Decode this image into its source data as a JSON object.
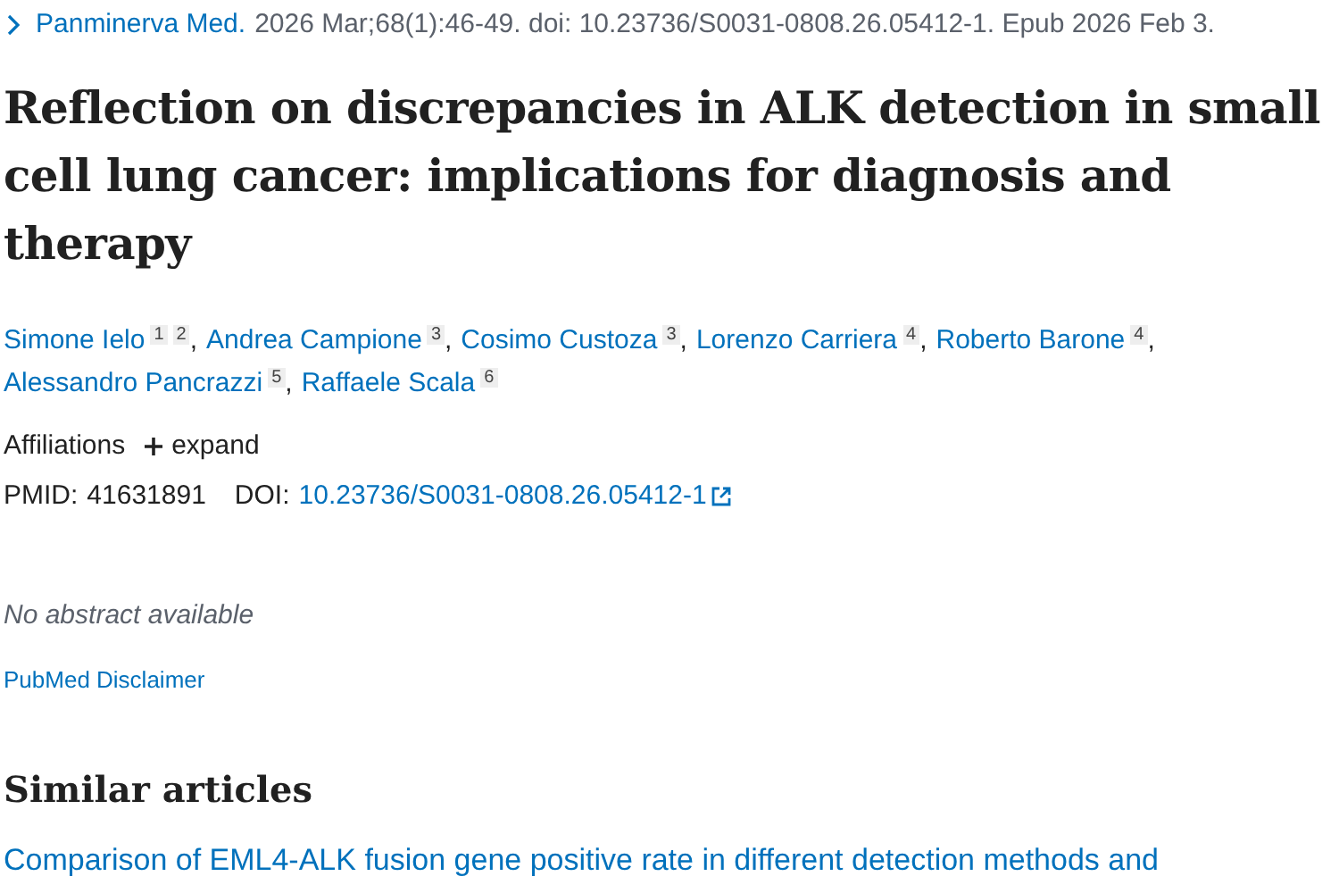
{
  "citation": {
    "journal": "Panminerva Med.",
    "details": "2026 Mar;68(1):46-49. doi: 10.23736/S0031-0808.26.05412-1. Epub 2026 Feb 3."
  },
  "title": "Reflection on discrepancies in ALK detection in small cell lung cancer: implications for diagnosis and therapy",
  "authors": [
    {
      "name": "Simone Ielo",
      "affiliations": [
        "1",
        "2"
      ]
    },
    {
      "name": "Andrea Campione",
      "affiliations": [
        "3"
      ]
    },
    {
      "name": "Cosimo Custoza",
      "affiliations": [
        "3"
      ]
    },
    {
      "name": "Lorenzo Carriera",
      "affiliations": [
        "4"
      ]
    },
    {
      "name": "Roberto Barone",
      "affiliations": [
        "4"
      ]
    },
    {
      "name": "Alessandro Pancrazzi",
      "affiliations": [
        "5"
      ]
    },
    {
      "name": "Raffaele Scala",
      "affiliations": [
        "6"
      ]
    }
  ],
  "author_separator": ",",
  "affiliations": {
    "label": "Affiliations",
    "toggle": "expand",
    "expanded": false
  },
  "identifiers": {
    "pmid_label": "PMID:",
    "pmid": "41631891",
    "doi_label": "DOI:",
    "doi": "10.23736/S0031-0808.26.05412-1"
  },
  "abstract": "No abstract available",
  "disclaimer": "PubMed Disclaimer",
  "similar_articles": {
    "heading": "Similar articles",
    "items": [
      "Comparison of EML4-ALK fusion gene positive rate in different detection methods and"
    ]
  }
}
